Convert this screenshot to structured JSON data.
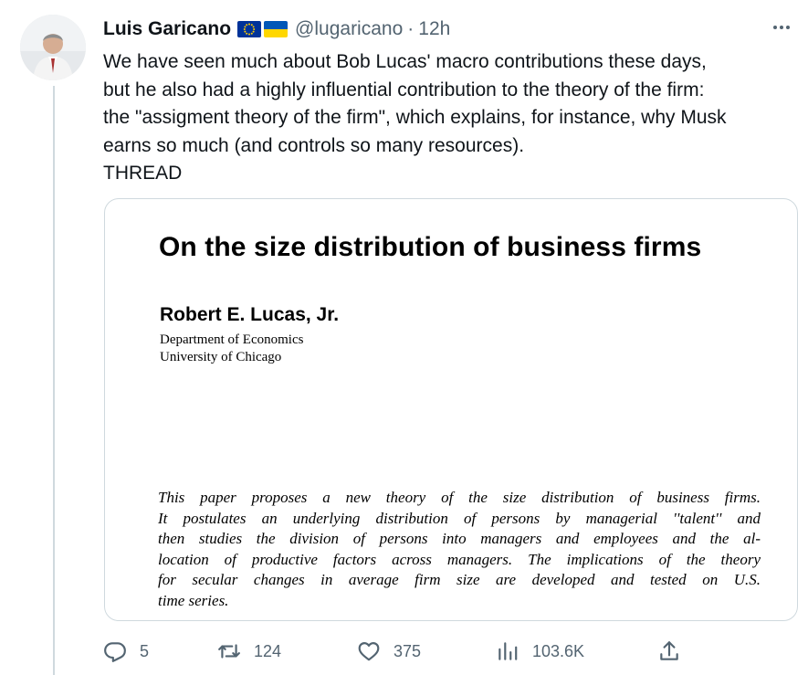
{
  "author": {
    "display_name": "Luis Garicano",
    "handle": "@lugaricano",
    "separator": "·",
    "time": "12h"
  },
  "tweet": {
    "lines": [
      "We  have seen much about Bob Lucas' macro contributions these days,",
      "but he also had a highly influential contribution to the theory of the firm:",
      "the \"assigment theory of the firm\", which explains, for instance, why Musk",
      "earns so much (and controls so many resources).",
      "THREAD"
    ]
  },
  "media": {
    "paper_title": "On the size distribution of business firms",
    "author": "Robert E. Lucas, Jr.",
    "department": "Department of Economics",
    "university": "University of Chicago",
    "abstract_lines": [
      "This paper proposes a new theory of the size distribution of business firms.",
      "It postulates an underlying distribution of persons by managerial ''talent'' and",
      "then studies the division of persons into managers and employees and the al-",
      "location of productive factors across managers. The implications of the theory",
      "for secular changes in average firm size are developed and tested on U.S.",
      "time series."
    ]
  },
  "actions": {
    "replies": "5",
    "retweets": "124",
    "likes": "375",
    "views": "103.6K"
  },
  "icons": {
    "more": "more-options-icon",
    "reply": "reply-icon",
    "retweet": "retweet-icon",
    "like": "heart-icon",
    "views": "analytics-icon",
    "share": "share-icon",
    "flag_eu": "eu-flag-icon",
    "flag_ua": "ukraine-flag-icon"
  },
  "colors": {
    "text_primary": "#0f1419",
    "text_secondary": "#536471",
    "border": "#cfd9de",
    "eu_blue": "#003399",
    "eu_star": "#ffcc00",
    "ua_blue": "#0057b7",
    "ua_yellow": "#ffd700"
  }
}
